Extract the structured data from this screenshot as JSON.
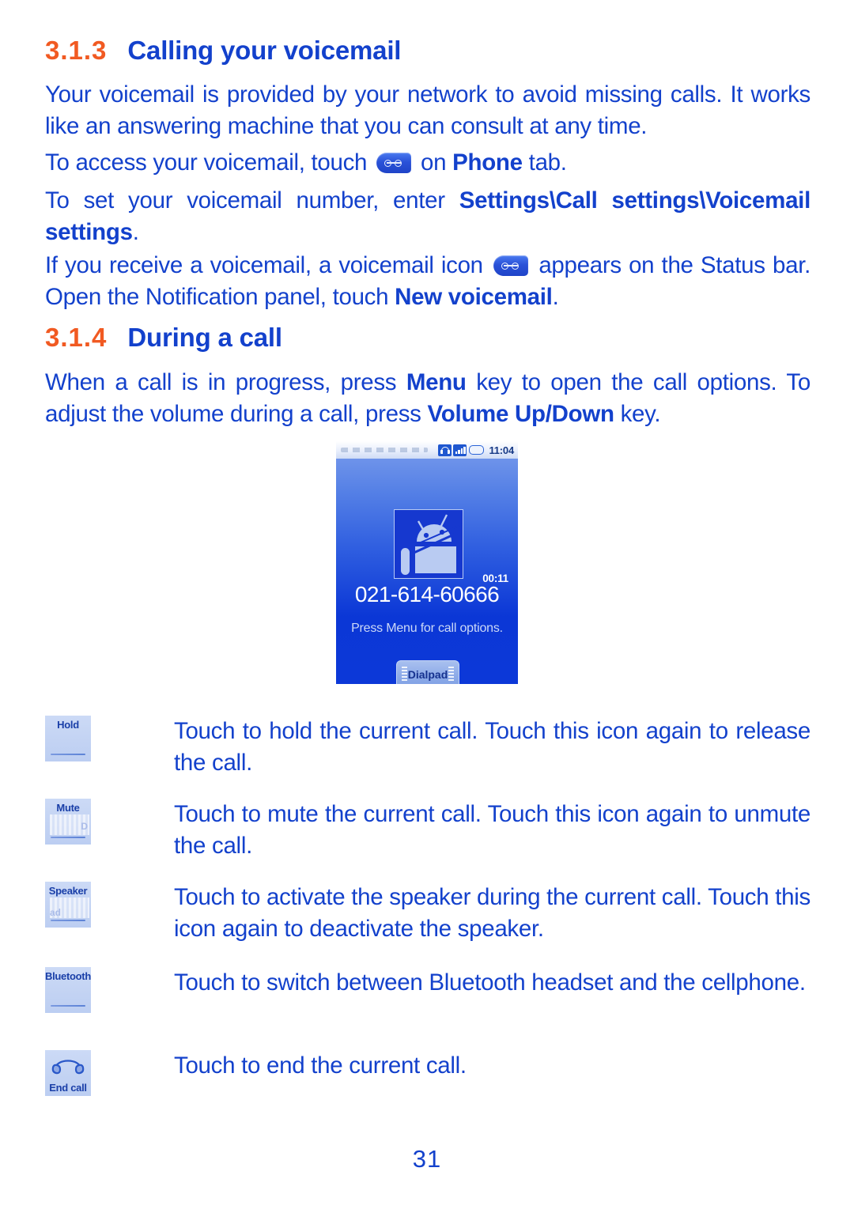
{
  "document": {
    "page_number": "31",
    "colors": {
      "heading_number": "#F15A22",
      "body_text": "#1341CC",
      "icon_button_bg": "#C6D5F4",
      "phone_screen_blue": "#0B37D6"
    }
  },
  "sections": [
    {
      "number": "3.1.3",
      "title": "Calling your voicemail"
    },
    {
      "number": "3.1.4",
      "title": "During a call"
    }
  ],
  "paragraphs": {
    "p1": "Your voicemail is provided by your network to avoid missing calls. It works like an answering machine that you can consult at any time.",
    "p2_before": "To access your voicemail, touch",
    "p2_after_a": "on",
    "p2_bold": "Phone",
    "p2_after_b": "tab.",
    "p3_before": "To set your voicemail number, enter",
    "p3_bold": "Settings\\Call settings\\Voicemail settings",
    "p3_after": ".",
    "p4_before": "If you receive a voicemail, a voicemail icon",
    "p4_mid": "appears on the Status bar. Open the Notification panel, touch",
    "p4_bold": "New voicemail",
    "p4_after": ".",
    "p5_a": "When a call is in progress, press",
    "p5_bold1": "Menu",
    "p5_b": "key to open the call options. To adjust the volume during a call, press",
    "p5_bold2": "Volume Up/Down",
    "p5_c": "key."
  },
  "phone_screenshot": {
    "status_bar": {
      "time": "11:04",
      "icons": [
        "headset-icon",
        "signal-strength-icon",
        "battery-icon"
      ]
    },
    "call_timer": "00:11",
    "phone_number": "021-614-60666",
    "hint": "Press Menu for call options.",
    "dialpad_label": "Dialpad"
  },
  "icon_rows": [
    {
      "icon_label": "Hold",
      "icon_name": "hold-button-icon",
      "description": "Touch to hold the current call. Touch this icon again to release the call."
    },
    {
      "icon_label": "Mute",
      "icon_name": "mute-button-icon",
      "description": "Touch to mute the current call. Touch this icon again to unmute the call."
    },
    {
      "icon_label": "Speaker",
      "icon_name": "speaker-button-icon",
      "description": "Touch to activate the speaker during the current call. Touch this icon again to deactivate the speaker."
    },
    {
      "icon_label": "Bluetooth",
      "icon_name": "bluetooth-button-icon",
      "description": "Touch to switch between Bluetooth headset and the cellphone."
    },
    {
      "icon_label": "End call",
      "icon_name": "end-call-button-icon",
      "description": "Touch to end the current call."
    }
  ]
}
